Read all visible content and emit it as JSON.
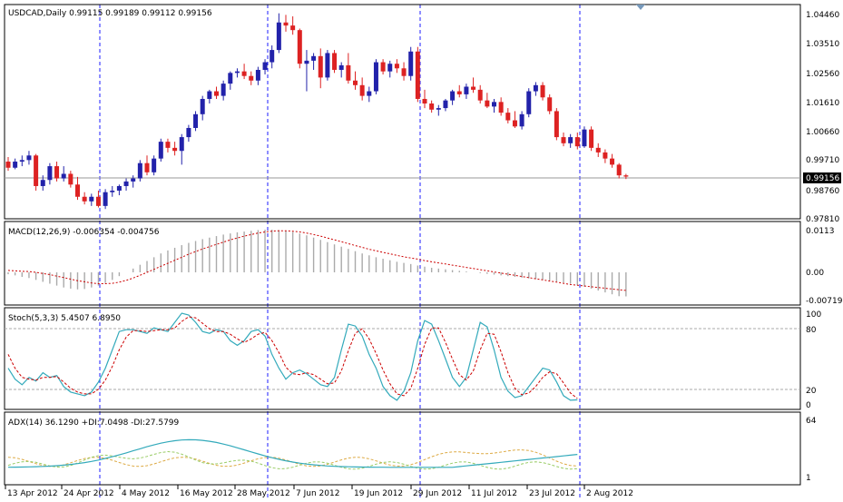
{
  "symbol_header": "USDCAD,Daily  0.99115 0.99189 0.99112 0.99156",
  "current_price_label": "0.99156",
  "colors": {
    "bull": "#2222aa",
    "bear": "#dd2222",
    "macd_hist": "#aaaaaa",
    "macd_signal": "#cc0000",
    "stoch_main": "#33aabb",
    "stoch_signal": "#cc0000",
    "adx": "#33aabb",
    "di_plus": "#99cc66",
    "di_minus": "#ddaa44",
    "grid_vertical": "#1c1cff",
    "frame": "#000000"
  },
  "main": {
    "price_ticks": [
      "1.04460",
      "1.03510",
      "1.02560",
      "1.01610",
      "1.00660",
      "0.99710",
      "0.98760",
      "0.97810"
    ],
    "tick_values": [
      1.0446,
      1.0351,
      1.0256,
      1.0161,
      1.0066,
      0.9971,
      0.9876,
      0.9781
    ]
  },
  "macd": {
    "title": "MACD(12,26,9) -0.006354 -0.004756",
    "ticks": [
      "0.0113",
      "0.00",
      "-0.00719"
    ]
  },
  "stoch": {
    "title": "Stoch(5,3,3) 5.4507 6.8950",
    "ticks": [
      "100",
      "80",
      "20",
      "0"
    ]
  },
  "adx": {
    "title": "ADX(14) 36.1290 +DI:7.0498 -DI:27.5799",
    "ticks": [
      "64",
      "1"
    ]
  },
  "date_labels": [
    "13 Apr 2012",
    "24 Apr 2012",
    "4 May 2012",
    "16 May 2012",
    "28 May 2012",
    "7 Jun 2012",
    "19 Jun 2012",
    "29 Jun 2012",
    "11 Jul 2012",
    "23 Jul 2012",
    "2 Aug 2012"
  ],
  "chart_data": {
    "type": "candlestick",
    "candles": [
      [
        0.9965,
        0.998,
        0.9935,
        0.9945
      ],
      [
        0.9945,
        0.9975,
        0.994,
        0.9965
      ],
      [
        0.9965,
        0.9985,
        0.995,
        0.997
      ],
      [
        0.997,
        1.0,
        0.9955,
        0.9985
      ],
      [
        0.9985,
        0.999,
        0.987,
        0.9885
      ],
      [
        0.9885,
        0.992,
        0.987,
        0.9905
      ],
      [
        0.9905,
        0.996,
        0.989,
        0.995
      ],
      [
        0.995,
        0.9965,
        0.99,
        0.991
      ],
      [
        0.991,
        0.995,
        0.99,
        0.9925
      ],
      [
        0.9925,
        0.9935,
        0.988,
        0.989
      ],
      [
        0.989,
        0.9915,
        0.984,
        0.985
      ],
      [
        0.985,
        0.9865,
        0.9825,
        0.9835
      ],
      [
        0.9835,
        0.986,
        0.982,
        0.985
      ],
      [
        0.985,
        0.987,
        0.9815,
        0.982
      ],
      [
        0.982,
        0.9875,
        0.981,
        0.9865
      ],
      [
        0.9865,
        0.9885,
        0.985,
        0.987
      ],
      [
        0.987,
        0.989,
        0.9855,
        0.9885
      ],
      [
        0.9885,
        0.991,
        0.987,
        0.99
      ],
      [
        0.99,
        0.992,
        0.988,
        0.991
      ],
      [
        0.991,
        0.997,
        0.99,
        0.996
      ],
      [
        0.996,
        0.9985,
        0.992,
        0.993
      ],
      [
        0.993,
        0.9985,
        0.992,
        0.9975
      ],
      [
        0.9975,
        1.004,
        0.9965,
        1.003
      ],
      [
        1.003,
        1.004,
        0.9995,
        1.001
      ],
      [
        1.001,
        1.003,
        0.9985,
        1.0
      ],
      [
        1.0,
        1.0055,
        0.9955,
        1.0045
      ],
      [
        1.0045,
        1.0085,
        1.003,
        1.0075
      ],
      [
        1.0075,
        1.013,
        1.0065,
        1.012
      ],
      [
        1.012,
        1.018,
        1.01,
        1.017
      ],
      [
        1.017,
        1.02,
        1.0155,
        1.0195
      ],
      [
        1.0195,
        1.021,
        1.017,
        1.018
      ],
      [
        1.018,
        1.023,
        1.0165,
        1.022
      ],
      [
        1.022,
        1.026,
        1.02,
        1.0255
      ],
      [
        1.0255,
        1.027,
        1.024,
        1.026
      ],
      [
        1.026,
        1.0285,
        1.0235,
        1.0245
      ],
      [
        1.0245,
        1.026,
        1.0215,
        1.023
      ],
      [
        1.023,
        1.0275,
        1.0215,
        1.0265
      ],
      [
        1.0265,
        1.03,
        1.025,
        1.029
      ],
      [
        1.029,
        1.0345,
        1.027,
        1.033
      ],
      [
        1.033,
        1.045,
        1.032,
        1.042
      ],
      [
        1.042,
        1.0445,
        1.039,
        1.041
      ],
      [
        1.041,
        1.044,
        1.038,
        1.0395
      ],
      [
        1.0395,
        1.04,
        1.027,
        1.0285
      ],
      [
        1.0285,
        1.033,
        1.0195,
        1.0295
      ],
      [
        1.0295,
        1.032,
        1.0265,
        1.031
      ],
      [
        1.031,
        1.0335,
        1.0205,
        1.024
      ],
      [
        1.024,
        1.033,
        1.023,
        1.032
      ],
      [
        1.032,
        1.033,
        1.0255,
        1.0265
      ],
      [
        1.0265,
        1.029,
        1.024,
        1.028
      ],
      [
        1.028,
        1.032,
        1.022,
        1.023
      ],
      [
        1.023,
        1.026,
        1.02,
        1.0215
      ],
      [
        1.0215,
        1.024,
        1.0165,
        1.018
      ],
      [
        1.018,
        1.021,
        1.016,
        1.0195
      ],
      [
        1.0195,
        1.03,
        1.0185,
        1.029
      ],
      [
        1.029,
        1.03,
        1.025,
        1.026
      ],
      [
        1.026,
        1.0295,
        1.024,
        1.0285
      ],
      [
        1.0285,
        1.03,
        1.0255,
        1.027
      ],
      [
        1.027,
        1.029,
        1.023,
        1.0245
      ],
      [
        1.0245,
        1.034,
        1.023,
        1.0325
      ],
      [
        1.0325,
        1.034,
        1.016,
        1.017
      ],
      [
        1.017,
        1.02,
        1.014,
        1.0155
      ],
      [
        1.0155,
        1.0165,
        1.0125,
        1.0135
      ],
      [
        1.0135,
        1.015,
        1.0115,
        1.014
      ],
      [
        1.014,
        1.017,
        1.013,
        1.0165
      ],
      [
        1.0165,
        1.02,
        1.015,
        1.0195
      ],
      [
        1.0195,
        1.0215,
        1.0175,
        1.0185
      ],
      [
        1.0185,
        1.022,
        1.017,
        1.021
      ],
      [
        1.021,
        1.024,
        1.019,
        1.02
      ],
      [
        1.02,
        1.0215,
        1.0155,
        1.0165
      ],
      [
        1.0165,
        1.019,
        1.014,
        1.0145
      ],
      [
        1.0145,
        1.017,
        1.0125,
        1.016
      ],
      [
        1.016,
        1.0175,
        1.0115,
        1.0125
      ],
      [
        1.0125,
        1.014,
        1.009,
        1.01
      ],
      [
        1.01,
        1.013,
        1.0075,
        1.008
      ],
      [
        1.008,
        1.013,
        1.007,
        1.012
      ],
      [
        1.012,
        1.0205,
        1.011,
        1.0195
      ],
      [
        1.0195,
        1.0225,
        1.018,
        1.0215
      ],
      [
        1.0215,
        1.0225,
        1.0165,
        1.0175
      ],
      [
        1.0175,
        1.0185,
        1.012,
        1.013
      ],
      [
        1.013,
        1.014,
        1.0035,
        1.0045
      ],
      [
        1.0045,
        1.006,
        1.0015,
        1.0025
      ],
      [
        1.0025,
        1.0055,
        1.001,
        1.0045
      ],
      [
        1.0045,
        1.006,
        1.0005,
        1.0015
      ],
      [
        1.0015,
        1.008,
        1.001,
        1.007
      ],
      [
        1.007,
        1.008,
        1.0,
        1.001
      ],
      [
        1.001,
        1.0025,
        0.998,
        0.9995
      ],
      [
        0.9995,
        1.0005,
        0.996,
        0.9975
      ],
      [
        0.9975,
        0.999,
        0.9945,
        0.9955
      ],
      [
        0.9955,
        0.996,
        0.991,
        0.992
      ],
      [
        0.992,
        0.9925,
        0.9908,
        0.9916
      ]
    ],
    "macd_hist": [
      -0.0005,
      -0.0008,
      -0.0012,
      -0.0015,
      -0.002,
      -0.0025,
      -0.003,
      -0.0035,
      -0.004,
      -0.0043,
      -0.0045,
      -0.0044,
      -0.004,
      -0.0035,
      -0.0028,
      -0.002,
      -0.001,
      0.0,
      0.001,
      0.002,
      0.003,
      0.004,
      0.005,
      0.0058,
      0.0065,
      0.0072,
      0.0078,
      0.0083,
      0.0088,
      0.0092,
      0.0096,
      0.01,
      0.0103,
      0.0106,
      0.0108,
      0.011,
      0.0112,
      0.0113,
      0.0113,
      0.0112,
      0.011,
      0.0107,
      0.0103,
      0.0098,
      0.0092,
      0.0086,
      0.008,
      0.0074,
      0.0068,
      0.0062,
      0.0056,
      0.005,
      0.0045,
      0.004,
      0.0036,
      0.0032,
      0.0028,
      0.0025,
      0.0022,
      0.0018,
      0.0015,
      0.0012,
      0.001,
      0.0008,
      0.0006,
      0.0004,
      0.0002,
      0.0,
      -0.0002,
      -0.0004,
      -0.0006,
      -0.0008,
      -0.001,
      -0.0012,
      -0.0014,
      -0.0016,
      -0.0018,
      -0.002,
      -0.0022,
      -0.0024,
      -0.0027,
      -0.003,
      -0.0034,
      -0.0038,
      -0.0043,
      -0.0048,
      -0.0053,
      -0.0058,
      -0.0063,
      -0.00635
    ],
    "macd_signal": [
      0.0005,
      0.0004,
      0.0003,
      0.0002,
      0.0,
      -0.0003,
      -0.0006,
      -0.001,
      -0.0014,
      -0.0018,
      -0.0022,
      -0.0025,
      -0.0028,
      -0.003,
      -0.003,
      -0.0029,
      -0.0026,
      -0.0021,
      -0.0015,
      -0.0008,
      0.0,
      0.0008,
      0.0016,
      0.0024,
      0.0032,
      0.004,
      0.0048,
      0.0055,
      0.0062,
      0.0068,
      0.0074,
      0.008,
      0.0086,
      0.0091,
      0.0096,
      0.01,
      0.0104,
      0.0107,
      0.0109,
      0.011,
      0.011,
      0.0109,
      0.0107,
      0.0104,
      0.01,
      0.0096,
      0.0091,
      0.0086,
      0.0081,
      0.0076,
      0.0071,
      0.0066,
      0.0061,
      0.0057,
      0.0053,
      0.0049,
      0.0045,
      0.0041,
      0.0038,
      0.0035,
      0.0031,
      0.0028,
      0.0025,
      0.0022,
      0.0019,
      0.0016,
      0.0013,
      0.001,
      0.0007,
      0.0004,
      0.0001,
      -0.0002,
      -0.0005,
      -0.0008,
      -0.0011,
      -0.0014,
      -0.0017,
      -0.002,
      -0.0023,
      -0.0026,
      -0.0029,
      -0.0032,
      -0.0034,
      -0.0036,
      -0.0038,
      -0.004,
      -0.0042,
      -0.0044,
      -0.0046,
      -0.00476
    ],
    "stoch_main": [
      40,
      28,
      22,
      30,
      26,
      35,
      30,
      32,
      20,
      14,
      12,
      10,
      14,
      25,
      40,
      60,
      80,
      82,
      82,
      80,
      78,
      84,
      82,
      80,
      90,
      100,
      98,
      90,
      80,
      78,
      82,
      80,
      70,
      65,
      70,
      80,
      82,
      75,
      55,
      40,
      28,
      35,
      38,
      34,
      28,
      22,
      20,
      30,
      60,
      88,
      86,
      75,
      55,
      40,
      20,
      10,
      5,
      15,
      35,
      70,
      92,
      88,
      70,
      50,
      30,
      20,
      30,
      60,
      90,
      85,
      60,
      30,
      15,
      8,
      10,
      20,
      30,
      40,
      38,
      25,
      10,
      5,
      5.45
    ],
    "stoch_signal": [
      55,
      40,
      30,
      28,
      27,
      30,
      30,
      31,
      25,
      18,
      14,
      12,
      12,
      17,
      27,
      42,
      60,
      74,
      81,
      81,
      80,
      81,
      82,
      82,
      84,
      91,
      96,
      95,
      89,
      83,
      80,
      80,
      77,
      72,
      68,
      72,
      77,
      79,
      70,
      57,
      41,
      34,
      33,
      35,
      33,
      28,
      23,
      24,
      37,
      59,
      78,
      83,
      72,
      56,
      38,
      23,
      12,
      10,
      18,
      40,
      66,
      84,
      84,
      68,
      50,
      33,
      27,
      37,
      60,
      78,
      77,
      58,
      35,
      18,
      11,
      13,
      20,
      30,
      36,
      34,
      24,
      13,
      6.9
    ]
  }
}
